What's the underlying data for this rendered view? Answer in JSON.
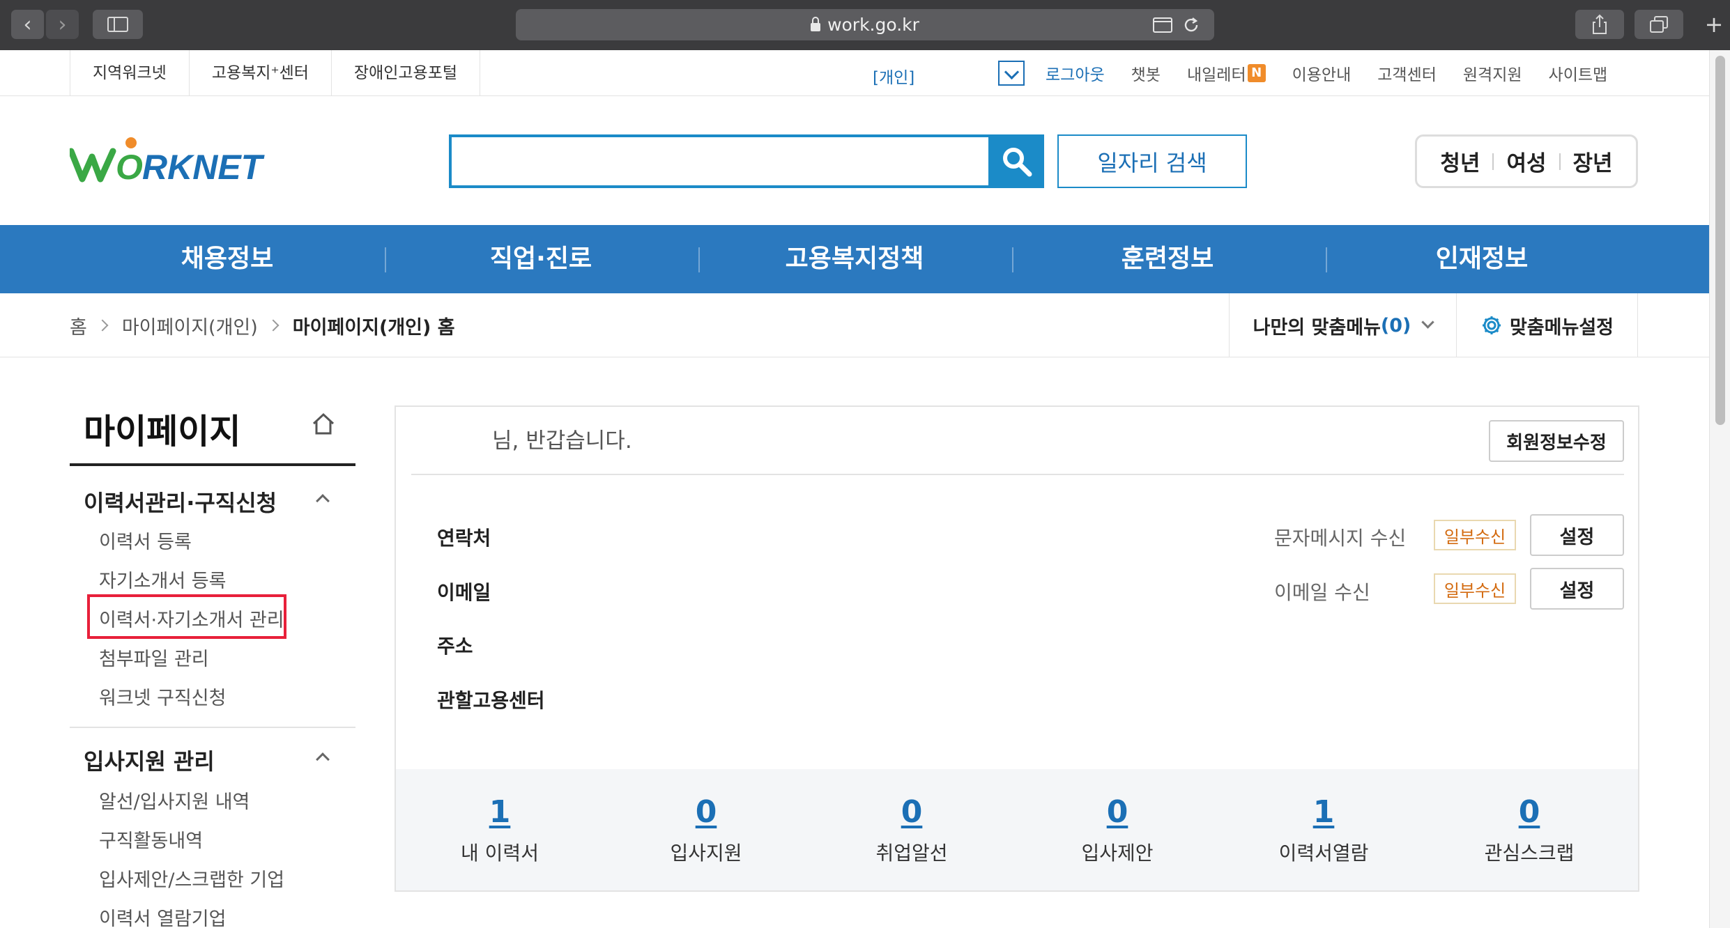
{
  "browser": {
    "url": "work.go.kr"
  },
  "util": {
    "links": [
      "지역워크넷",
      "고용복지⁺센터",
      "장애인고용포털"
    ],
    "personal": "[개인]",
    "right": {
      "logout": "로그아웃",
      "chatbot": "챗봇",
      "letter": "내일레터",
      "letter_badge": "N",
      "guide": "이용안내",
      "support": "고객센터",
      "remote": "원격지원",
      "sitemap": "사이트맵"
    }
  },
  "header": {
    "logo_text": "WORKNET",
    "search_value": "",
    "job_search": "일자리 검색",
    "age": [
      "청년",
      "여성",
      "장년"
    ]
  },
  "gnb": [
    "채용정보",
    "직업·진로",
    "고용복지정책",
    "훈련정보",
    "인재정보"
  ],
  "breadcrumb": {
    "home": "홈",
    "level1": "마이페이지(개인)",
    "current": "마이페이지(개인) 홈"
  },
  "mymenu": {
    "label": "나만의 맞춤메뉴",
    "count": "(0)",
    "settings": "맞춤메뉴설정"
  },
  "sidebar": {
    "title": "마이페이지",
    "sections": [
      {
        "title": "이력서관리·구직신청",
        "items": [
          "이력서 등록",
          "자기소개서 등록",
          "이력서·자기소개서 관리",
          "첨부파일 관리",
          "워크넷 구직신청"
        ]
      },
      {
        "title": "입사지원 관리",
        "items": [
          "알선/입사지원 내역",
          "구직활동내역",
          "입사제안/스크랩한 기업",
          "이력서 열람기업"
        ]
      }
    ]
  },
  "profile": {
    "greeting": "님, 반갑습니다.",
    "edit_button": "회원정보수정",
    "contact_label": "연락처",
    "email_label": "이메일",
    "address_label": "주소",
    "center_label": "관할고용센터",
    "sms_label": "문자메시지 수신",
    "sms_status": "일부수신",
    "email_recv_label": "이메일 수신",
    "email_status": "일부수신",
    "set_button": "설정"
  },
  "stats": [
    {
      "value": "1",
      "label": "내 이력서"
    },
    {
      "value": "0",
      "label": "입사지원"
    },
    {
      "value": "0",
      "label": "취업알선"
    },
    {
      "value": "0",
      "label": "입사제안"
    },
    {
      "value": "1",
      "label": "이력서열람"
    },
    {
      "value": "0",
      "label": "관심스크랩"
    }
  ],
  "colors": {
    "brand_blue": "#2b79bf",
    "link_blue": "#1b6fb5",
    "highlight_red": "#e8203a",
    "logo_green": "#3aa845",
    "logo_orange": "#f08c2a"
  }
}
